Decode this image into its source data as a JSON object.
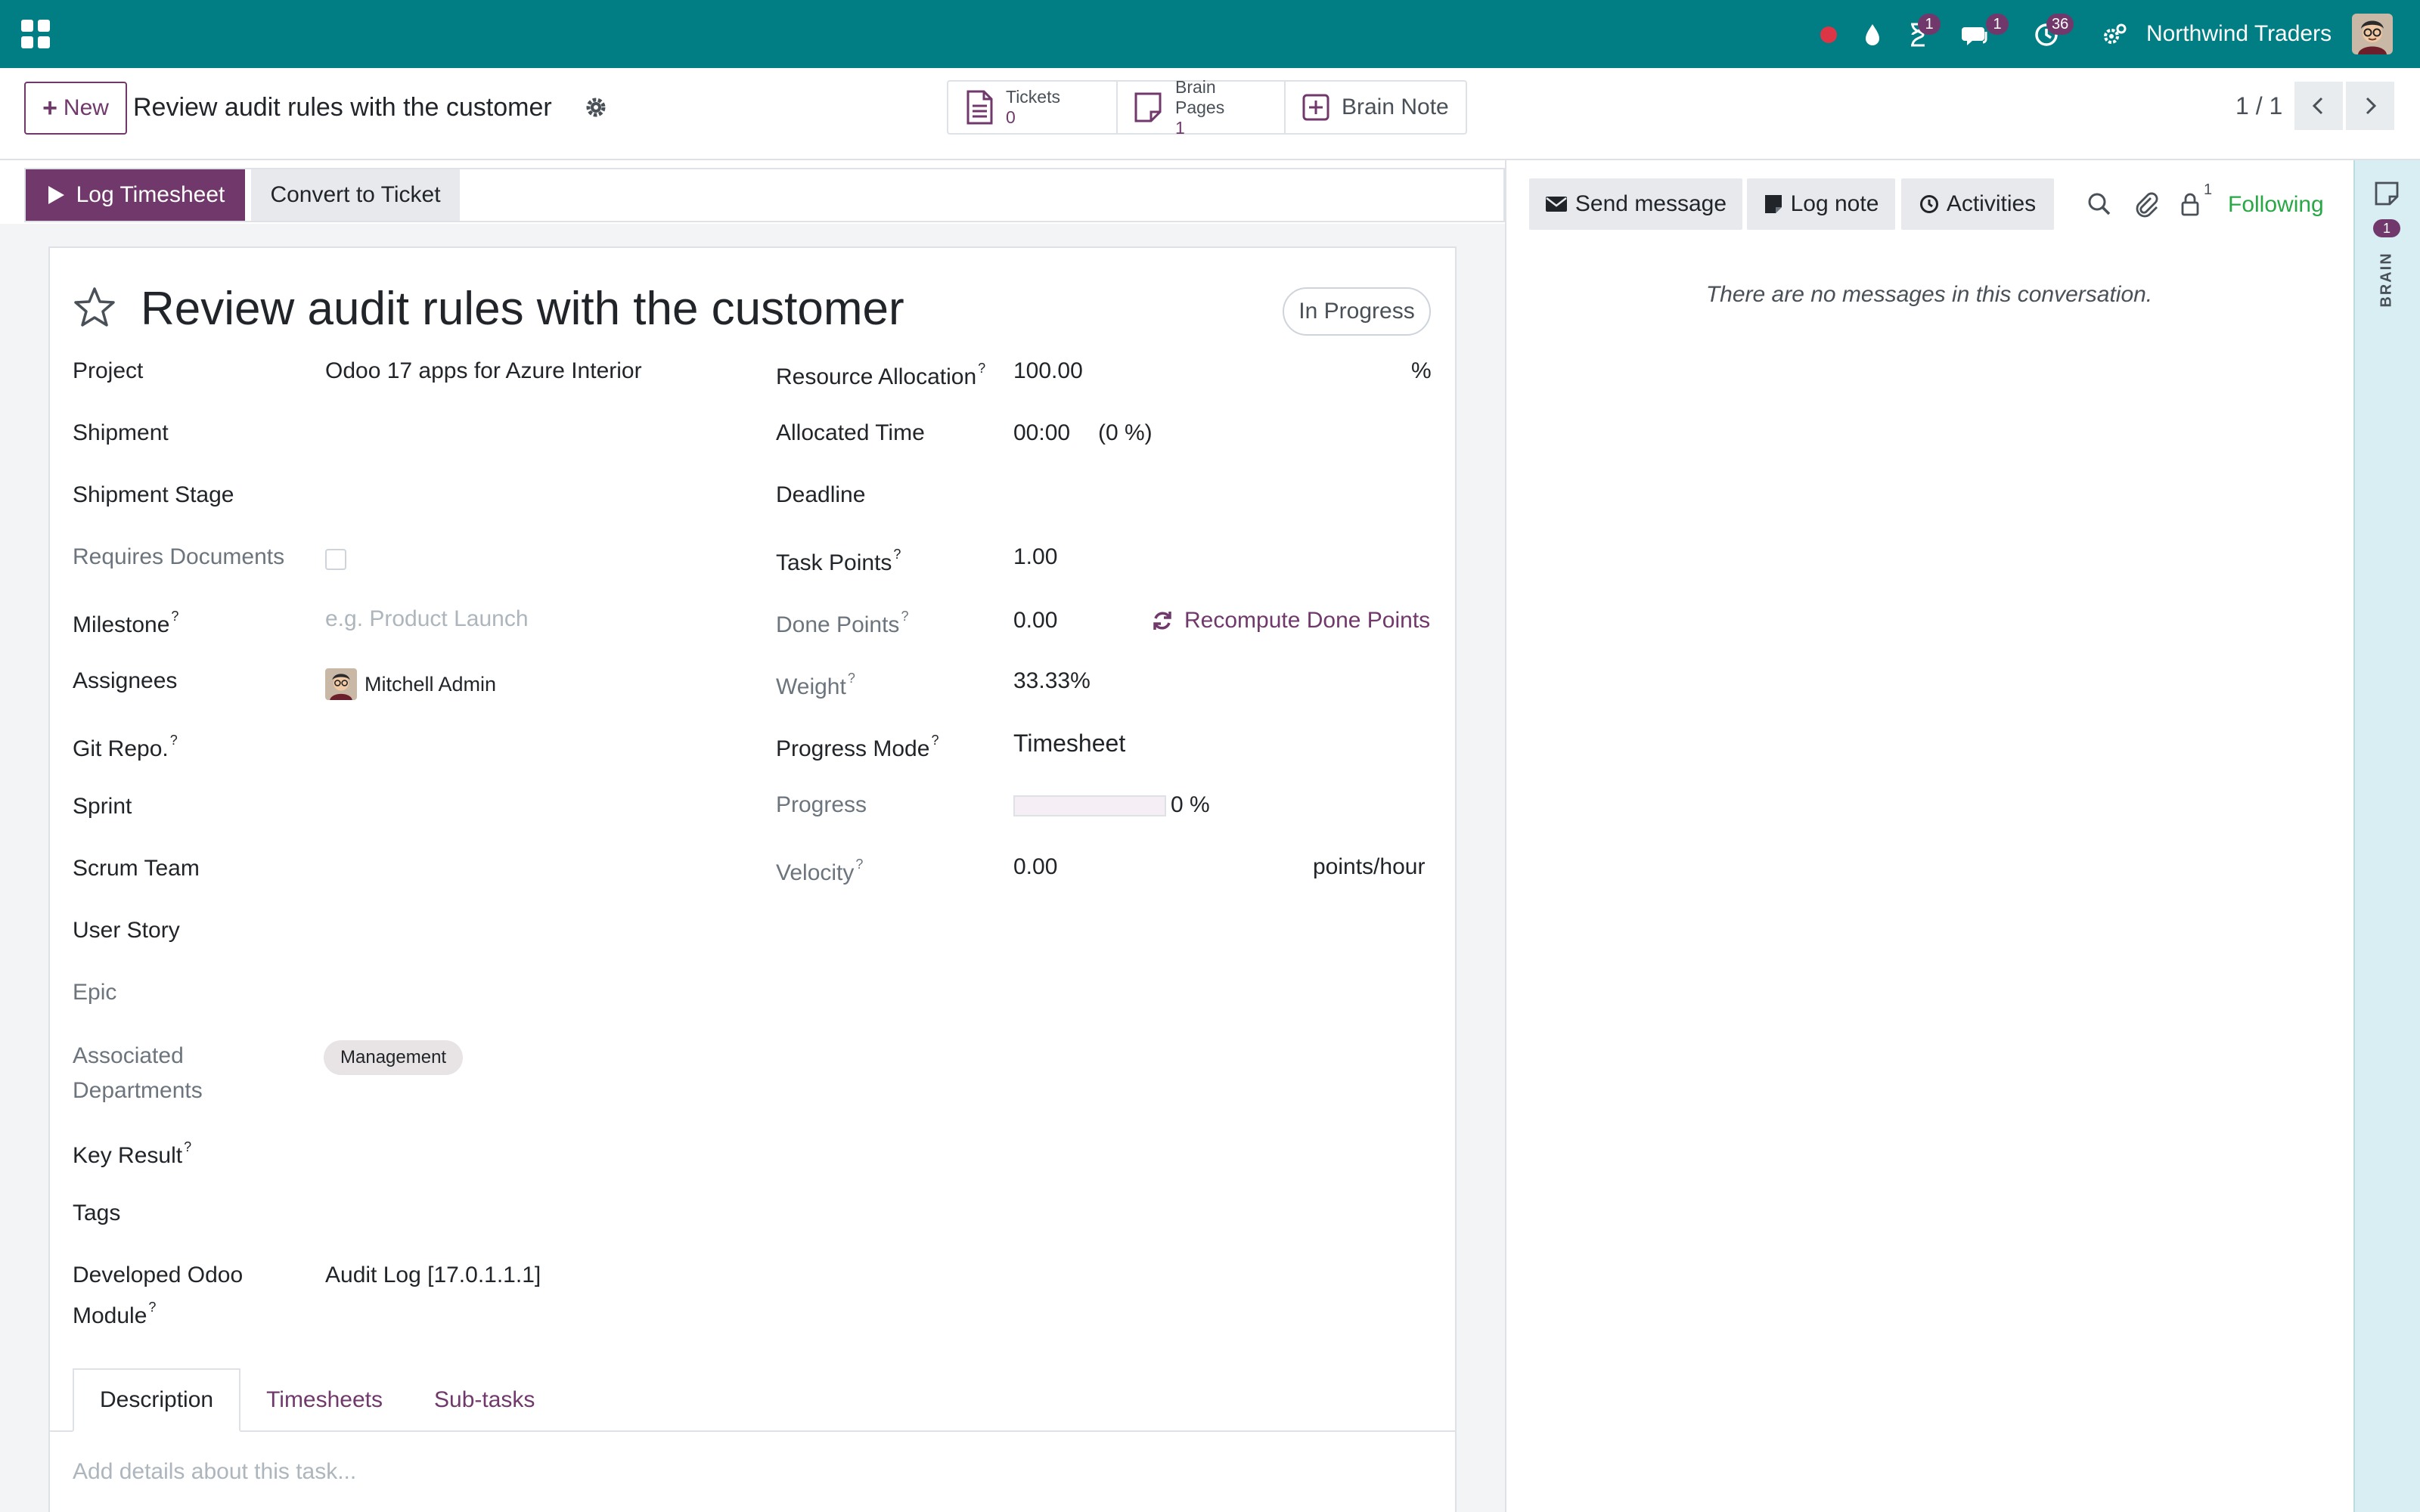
{
  "navbar": {
    "company": "Northwind Traders",
    "badges": {
      "activities": "1",
      "messages": "1",
      "clock": "36"
    }
  },
  "control_panel": {
    "new_label": "New",
    "breadcrumb": "Review audit rules with the customer",
    "smart_buttons": {
      "tickets_label": "Tickets",
      "tickets_value": "0",
      "brain_pages_label": "Brain Pages",
      "brain_pages_value": "1",
      "brain_note_label": "Brain Note"
    },
    "pager": "1 / 1"
  },
  "statusbar": {
    "log_timesheet": "Log Timesheet",
    "convert_ticket": "Convert to Ticket"
  },
  "form": {
    "title": "Review audit rules with the customer",
    "stage": "In Progress",
    "left": {
      "project_label": "Project",
      "project_value": "Odoo 17 apps for Azure Interior",
      "shipment_label": "Shipment",
      "shipment_stage_label": "Shipment Stage",
      "requires_documents_label": "Requires Documents",
      "milestone_label": "Milestone",
      "milestone_placeholder": "e.g. Product Launch",
      "assignees_label": "Assignees",
      "assignee_name": "Mitchell Admin",
      "git_repo_label": "Git Repo.",
      "sprint_label": "Sprint",
      "scrum_team_label": "Scrum Team",
      "user_story_label": "User Story",
      "epic_label": "Epic",
      "associated_departments_label_1": "Associated",
      "associated_departments_label_2": "Departments",
      "department_tag": "Management",
      "key_result_label": "Key Result",
      "tags_label": "Tags",
      "developed_module_label_1": "Developed Odoo",
      "developed_module_label_2": "Module",
      "developed_module_value": "Audit Log [17.0.1.1.1]"
    },
    "right": {
      "resource_allocation_label": "Resource Allocation",
      "resource_allocation_value": "100.00",
      "resource_allocation_unit": "%",
      "allocated_time_label": "Allocated Time",
      "allocated_time_value": "00:00",
      "allocated_time_percent": "(0 %)",
      "deadline_label": "Deadline",
      "task_points_label": "Task Points",
      "task_points_value": "1.00",
      "done_points_label": "Done Points",
      "done_points_value": "0.00",
      "recompute_label": "Recompute Done Points",
      "weight_label": "Weight",
      "weight_value": "33.33%",
      "progress_mode_label": "Progress Mode",
      "progress_mode_value": "Timesheet",
      "progress_label": "Progress",
      "progress_text": "0 %",
      "progress_fraction": 0,
      "velocity_label": "Velocity",
      "velocity_value": "0.00",
      "velocity_unit": "points/hour"
    },
    "help_mark": "?",
    "tabs": [
      "Description",
      "Timesheets",
      "Sub-tasks"
    ],
    "description_placeholder": "Add details about this task..."
  },
  "chatter": {
    "send_message": "Send message",
    "log_note": "Log note",
    "activities": "Activities",
    "followers_count": "1",
    "following": "Following",
    "empty": "There are no messages in this conversation."
  },
  "brain_panel": {
    "badge": "1",
    "label": "BRAIN"
  },
  "colors": {
    "navbar": "#017e84",
    "primary": "#71396b",
    "following": "#28a745",
    "brain_panel": "#d9eef2"
  }
}
